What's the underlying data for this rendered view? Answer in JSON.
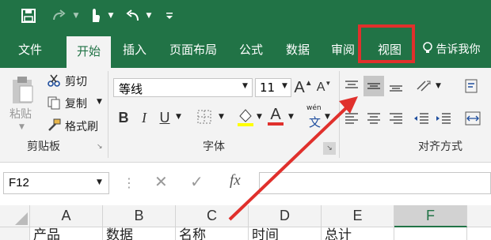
{
  "qat": {
    "save_icon": "save-icon",
    "touch_icon": "touch-mode-icon",
    "undo_icon": "undo-icon",
    "customize_icon": "customize-qat-icon"
  },
  "tabs": [
    {
      "label": "文件"
    },
    {
      "label": "开始"
    },
    {
      "label": "插入"
    },
    {
      "label": "页面布局"
    },
    {
      "label": "公式"
    },
    {
      "label": "数据"
    },
    {
      "label": "审阅"
    },
    {
      "label": "视图"
    }
  ],
  "tell_me": "告诉我你",
  "clipboard": {
    "paste": "粘贴",
    "cut": "剪切",
    "copy": "复制",
    "format_painter": "格式刷",
    "group": "剪贴板"
  },
  "font": {
    "name": "等线",
    "size": "11",
    "grow": "A",
    "shrink": "A",
    "bold": "B",
    "italic": "I",
    "underline": "U",
    "font_color_letter": "A",
    "wen": "wén",
    "wen_char": "文",
    "group": "字体"
  },
  "alignment": {
    "group": "对齐方式"
  },
  "namebox": "F12",
  "formula_icons": {
    "cancel": "✕",
    "confirm": "✓",
    "fx": "fx"
  },
  "columns": [
    "A",
    "B",
    "C",
    "D",
    "E",
    "F"
  ],
  "row1": [
    "产品",
    "数据",
    "名称",
    "时间",
    "总计"
  ],
  "colors": {
    "brand": "#217346",
    "highlight_border": "#e0302c",
    "arrow": "#e0302c"
  }
}
